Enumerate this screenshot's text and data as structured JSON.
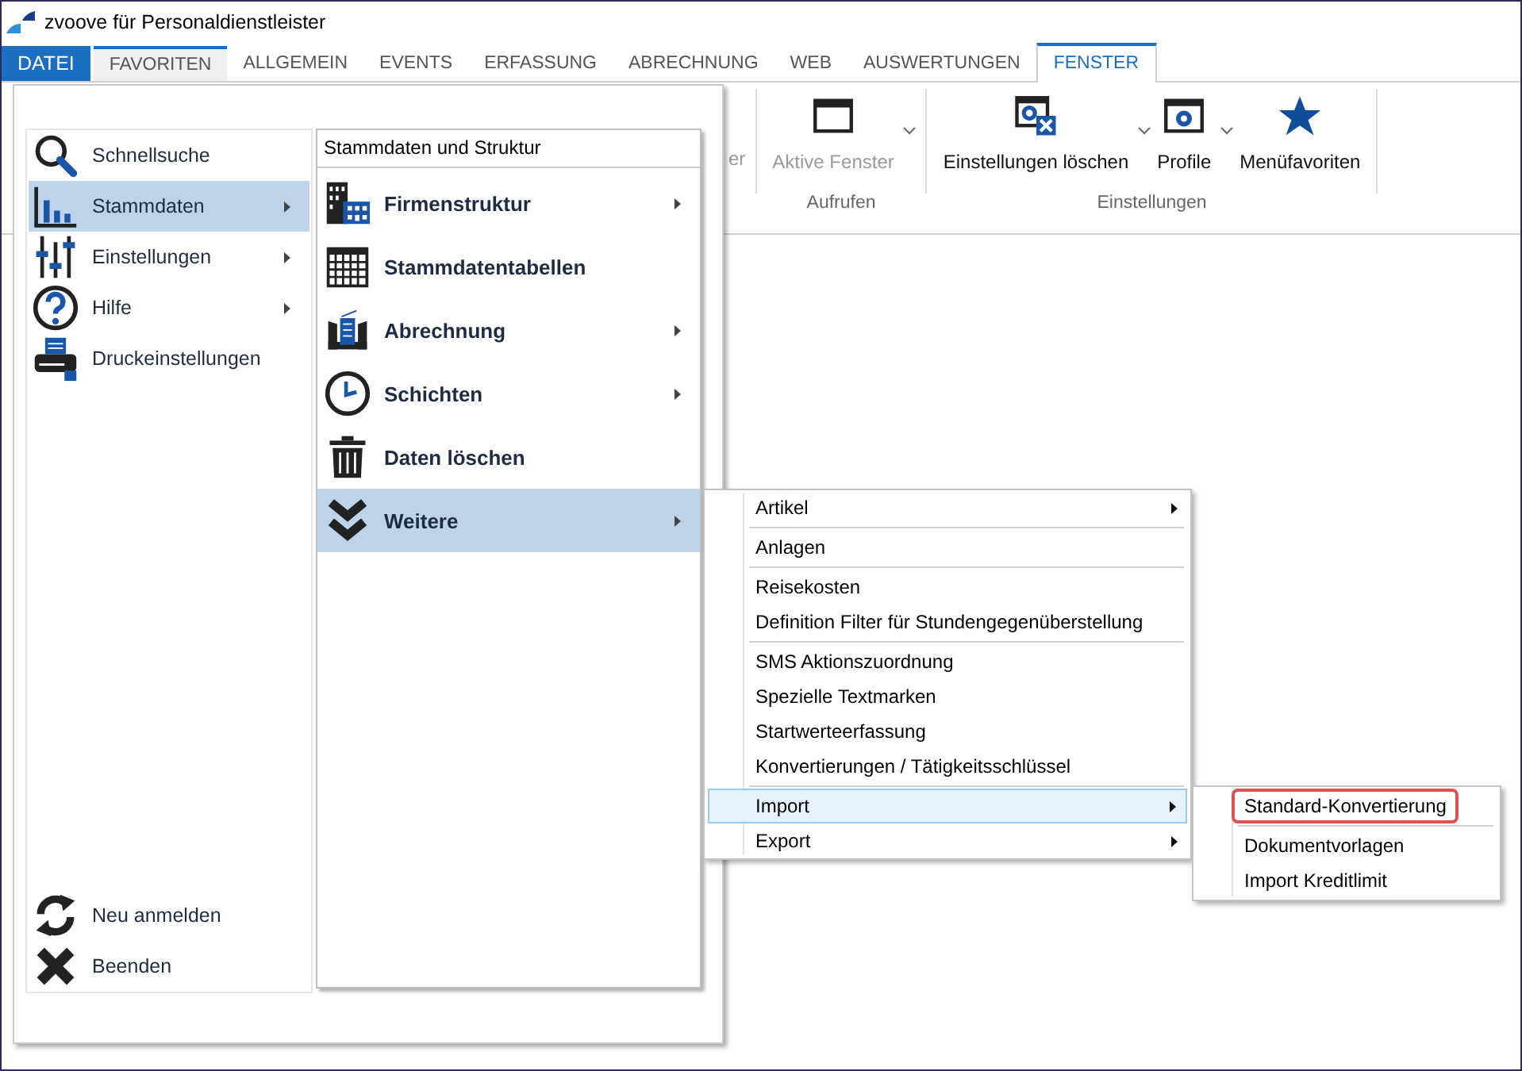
{
  "window": {
    "title": "zvoove für Personaldienstleister"
  },
  "tabs": [
    {
      "label": "DATEI",
      "kind": "file",
      "selected": false,
      "hovered": false
    },
    {
      "label": "FAVORITEN",
      "kind": "tab",
      "selected": false,
      "hovered": true
    },
    {
      "label": "ALLGEMEIN",
      "kind": "tab",
      "selected": false,
      "hovered": false
    },
    {
      "label": "EVENTS",
      "kind": "tab",
      "selected": false,
      "hovered": false
    },
    {
      "label": "ERFASSUNG",
      "kind": "tab",
      "selected": false,
      "hovered": false
    },
    {
      "label": "ABRECHNUNG",
      "kind": "tab",
      "selected": false,
      "hovered": false
    },
    {
      "label": "WEB",
      "kind": "tab",
      "selected": false,
      "hovered": false
    },
    {
      "label": "AUSWERTUNGEN",
      "kind": "tab",
      "selected": false,
      "hovered": false
    },
    {
      "label": "FENSTER",
      "kind": "tab",
      "selected": true,
      "hovered": false
    }
  ],
  "ribbon": {
    "cut_label": "er",
    "groups": [
      {
        "label": "Aufrufen",
        "buttons": [
          {
            "label": "Aktive Fenster",
            "disabled": true,
            "dropdown": true
          }
        ]
      },
      {
        "label": "Einstellungen",
        "buttons": [
          {
            "label": "Einstellungen löschen",
            "disabled": false,
            "dropdown": true
          },
          {
            "label": "Profile",
            "disabled": false,
            "dropdown": true
          },
          {
            "label": "Menüfavoriten",
            "disabled": false,
            "dropdown": false
          }
        ]
      }
    ]
  },
  "file_menu": {
    "items": [
      {
        "label": "Schnellsuche",
        "submenu": false,
        "selected": false
      },
      {
        "label": "Stammdaten",
        "submenu": true,
        "selected": true
      },
      {
        "label": "Einstellungen",
        "submenu": true,
        "selected": false
      },
      {
        "label": "Hilfe",
        "submenu": true,
        "selected": false
      },
      {
        "label": "Druckeinstellungen",
        "submenu": false,
        "selected": false
      }
    ],
    "bottom_items": [
      {
        "label": "Neu anmelden",
        "submenu": false,
        "selected": false
      },
      {
        "label": "Beenden",
        "submenu": false,
        "selected": false
      }
    ]
  },
  "stammdaten_menu": {
    "header": "Stammdaten und Struktur",
    "items": [
      {
        "label": "Firmenstruktur",
        "submenu": true,
        "selected": false
      },
      {
        "label": "Stammdatentabellen",
        "submenu": false,
        "selected": false
      },
      {
        "label": "Abrechnung",
        "submenu": true,
        "selected": false
      },
      {
        "label": "Schichten",
        "submenu": true,
        "selected": false
      },
      {
        "label": "Daten löschen",
        "submenu": false,
        "selected": false
      },
      {
        "label": "Weitere",
        "submenu": true,
        "selected": true
      }
    ]
  },
  "weitere_menu": {
    "groups": [
      {
        "items": [
          {
            "label": "Artikel",
            "submenu": true,
            "hovered": false
          }
        ]
      },
      {
        "items": [
          {
            "label": "Anlagen",
            "submenu": false,
            "hovered": false
          }
        ]
      },
      {
        "items": [
          {
            "label": "Reisekosten",
            "submenu": false,
            "hovered": false
          },
          {
            "label": "Definition Filter für Stundengegenüberstellung",
            "submenu": false,
            "hovered": false
          }
        ]
      },
      {
        "items": [
          {
            "label": "SMS Aktionszuordnung",
            "submenu": false,
            "hovered": false
          },
          {
            "label": "Spezielle Textmarken",
            "submenu": false,
            "hovered": false
          },
          {
            "label": "Startwerteerfassung",
            "submenu": false,
            "hovered": false
          },
          {
            "label": "Konvertierungen / Tätigkeitsschlüssel",
            "submenu": false,
            "hovered": false
          }
        ]
      },
      {
        "items": [
          {
            "label": "Import",
            "submenu": true,
            "hovered": true
          },
          {
            "label": "Export",
            "submenu": true,
            "hovered": false
          }
        ]
      }
    ]
  },
  "import_menu": {
    "groups": [
      {
        "items": [
          {
            "label": "Standard-Konvertierung",
            "outlined": true
          }
        ]
      },
      {
        "items": [
          {
            "label": "Dokumentvorlagen",
            "outlined": false
          },
          {
            "label": "Import Kreditlimit",
            "outlined": false
          }
        ]
      }
    ]
  }
}
